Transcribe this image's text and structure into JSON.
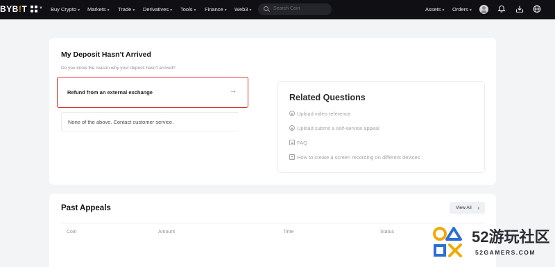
{
  "topnav": {
    "logo_text": "BYB",
    "logo_mark": "!",
    "logo_tail": "T",
    "items": [
      "Buy Crypto",
      "Markets",
      "Trade",
      "Derivatives",
      "Tools",
      "Finance",
      "Web3"
    ],
    "search_placeholder": "Search Coin",
    "right": [
      "Assets",
      "Orders"
    ],
    "icons": [
      "avatar",
      "bell-icon",
      "download-icon",
      "globe-icon"
    ]
  },
  "deposit": {
    "title": "My Deposit Hasn't Arrived",
    "subtitle": "Do you know the reason why your deposit hasn't arrived?",
    "option_selected": "Refund from an external exchange",
    "option_other": "None of the above. Contact customer service."
  },
  "related": {
    "title": "Related Questions",
    "items": [
      "Upload video reference",
      "Upload submit a self-service appeal",
      "FAQ",
      "How to create a screen recording on different devices"
    ]
  },
  "appeals": {
    "title": "Past Appeals",
    "view_all": "View All",
    "columns": [
      "Coin",
      "Amount",
      "Time",
      "Status"
    ]
  },
  "watermark": {
    "big": "52游玩社区",
    "small": "52GAMERS.COM"
  },
  "colors": {
    "nav_bg": "#101014",
    "highlight_border": "#e02a2a",
    "page_bg": "#f3f4f6"
  }
}
